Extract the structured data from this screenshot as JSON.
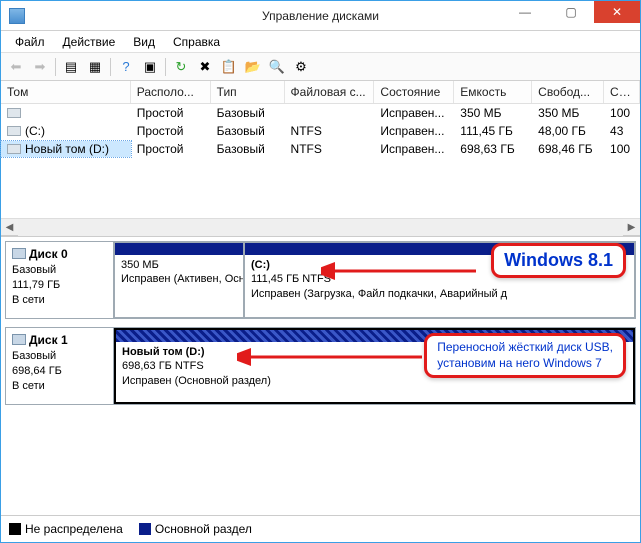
{
  "window": {
    "title": "Управление дисками"
  },
  "menu": {
    "file": "Файл",
    "action": "Действие",
    "view": "Вид",
    "help": "Справка"
  },
  "columns": {
    "volume": "Том",
    "layout": "Располо...",
    "type": "Тип",
    "fs": "Файловая с...",
    "state": "Состояние",
    "capacity": "Емкость",
    "free": "Свобод...",
    "pct": "Св..."
  },
  "volumes": [
    {
      "name": "",
      "layout": "Простой",
      "type": "Базовый",
      "fs": "",
      "state": "Исправен...",
      "capacity": "350 МБ",
      "free": "350 МБ",
      "pct": "100"
    },
    {
      "name": "(C:)",
      "layout": "Простой",
      "type": "Базовый",
      "fs": "NTFS",
      "state": "Исправен...",
      "capacity": "111,45 ГБ",
      "free": "48,00 ГБ",
      "pct": "43"
    },
    {
      "name": "Новый том (D:)",
      "layout": "Простой",
      "type": "Базовый",
      "fs": "NTFS",
      "state": "Исправен...",
      "capacity": "698,63 ГБ",
      "free": "698,46 ГБ",
      "pct": "100"
    }
  ],
  "disks": [
    {
      "label": "Диск 0",
      "type": "Базовый",
      "size": "111,79 ГБ",
      "status": "В сети",
      "partitions": [
        {
          "title": "",
          "line2": "350 МБ",
          "line3": "Исправен (Активен, Осн"
        },
        {
          "title": "(C:)",
          "line2": "111,45 ГБ NTFS",
          "line3": "Исправен (Загрузка, Файл подкачки, Аварийный д"
        }
      ]
    },
    {
      "label": "Диск 1",
      "type": "Базовый",
      "size": "698,64 ГБ",
      "status": "В сети",
      "partitions": [
        {
          "title": "Новый том  (D:)",
          "line2": "698,63 ГБ NTFS",
          "line3": "Исправен (Основной раздел)"
        }
      ]
    }
  ],
  "legend": {
    "unalloc": "Не распределена",
    "primary": "Основной раздел"
  },
  "callouts": {
    "c1": "Windows 8.1",
    "c2a": "Переносной жёсткий диск USB,",
    "c2b": "установим на него Windows 7"
  }
}
